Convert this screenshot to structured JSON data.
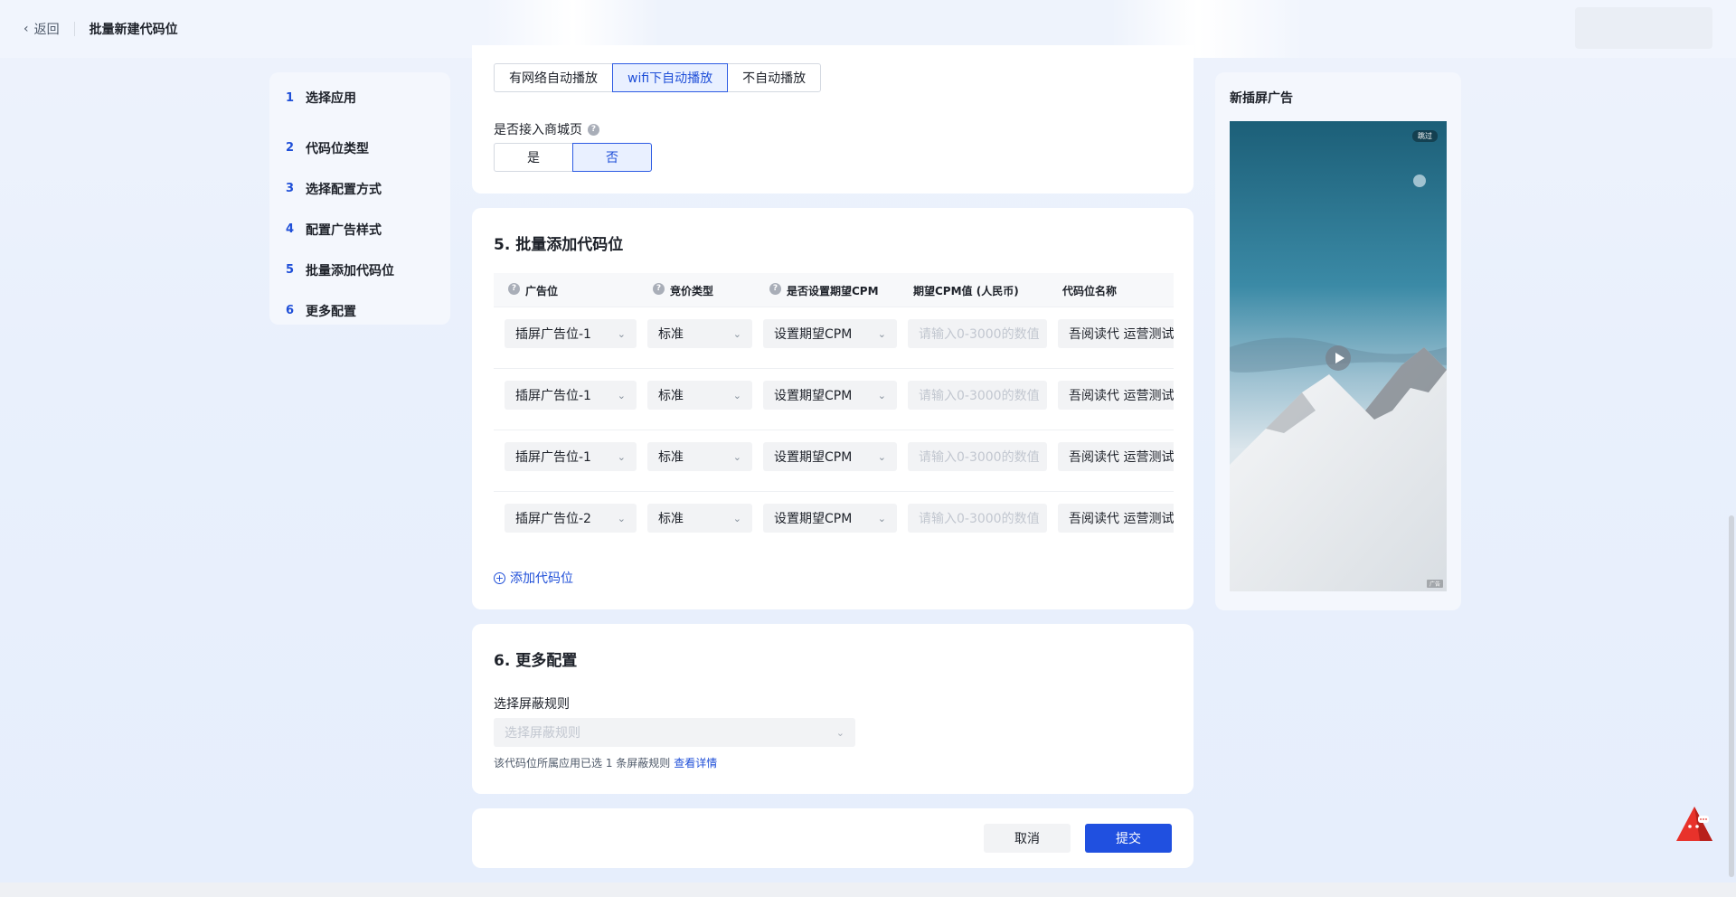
{
  "header": {
    "back_label": "返回",
    "title": "批量新建代码位"
  },
  "steps": [
    {
      "num": "1",
      "label": "选择应用"
    },
    {
      "num": "2",
      "label": "代码位类型"
    },
    {
      "num": "3",
      "label": "选择配置方式"
    },
    {
      "num": "4",
      "label": "配置广告样式"
    },
    {
      "num": "5",
      "label": "批量添加代码位"
    },
    {
      "num": "6",
      "label": "更多配置"
    }
  ],
  "autoplay": {
    "options": [
      "有网络自动播放",
      "wifi下自动播放",
      "不自动播放"
    ],
    "selected": "wifi下自动播放"
  },
  "mall": {
    "label": "是否接入商城页",
    "options": [
      "是",
      "否"
    ],
    "selected": "否"
  },
  "section5": {
    "title": "5. 批量添加代码位",
    "columns": [
      "广告位",
      "竞价类型",
      "是否设置期望CPM",
      "期望CPM值 (人民币)",
      "代码位名称"
    ],
    "rows": [
      {
        "slot": "插屏广告位-1",
        "bid": "标准",
        "cpm_setting": "设置期望CPM",
        "cpm_placeholder": "请输入0-3000的数值",
        "name": "吾阅读代 运营测试"
      },
      {
        "slot": "插屏广告位-1",
        "bid": "标准",
        "cpm_setting": "设置期望CPM",
        "cpm_placeholder": "请输入0-3000的数值",
        "name": "吾阅读代 运营测试"
      },
      {
        "slot": "插屏广告位-1",
        "bid": "标准",
        "cpm_setting": "设置期望CPM",
        "cpm_placeholder": "请输入0-3000的数值",
        "name": "吾阅读代 运营测试"
      },
      {
        "slot": "插屏广告位-2",
        "bid": "标准",
        "cpm_setting": "设置期望CPM",
        "cpm_placeholder": "请输入0-3000的数值",
        "name": "吾阅读代 运营测试"
      }
    ],
    "add_label": "添加代码位"
  },
  "section6": {
    "title": "6. 更多配置",
    "field_label": "选择屏蔽规则",
    "placeholder": "选择屏蔽规则",
    "hint": "该代码位所属应用已选 1 条屏蔽规则",
    "hint_link": "查看详情"
  },
  "actions": {
    "cancel": "取消",
    "submit": "提交"
  },
  "preview": {
    "title": "新插屏广告",
    "skip": "跳过",
    "ad_tag": "广告"
  },
  "colors": {
    "primary": "#2050e0",
    "selected_bg": "#e9f0ff",
    "page_bg": "#eef3fc"
  }
}
